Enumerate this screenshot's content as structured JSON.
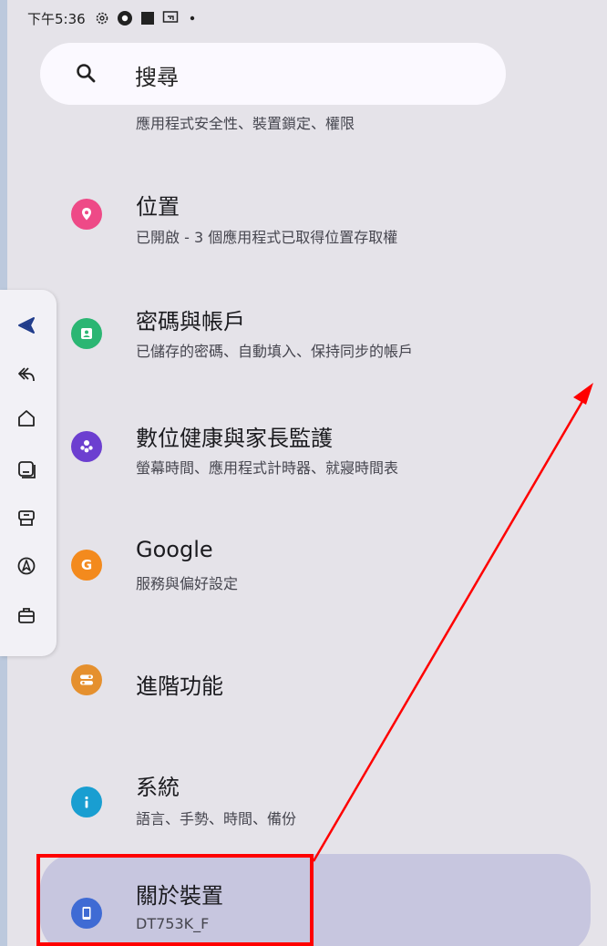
{
  "status_bar": {
    "time": "下午5:36"
  },
  "search": {
    "label": "搜尋"
  },
  "partial_item": {
    "subtitle": "應用程式安全性、裝置鎖定、權限"
  },
  "items": [
    {
      "title": "位置",
      "subtitle": "已開啟 - 3 個應用程式已取得位置存取權",
      "icon": "location-icon",
      "color": "#ee4a87"
    },
    {
      "title": "密碼與帳戶",
      "subtitle": "已儲存的密碼、自動填入、保持同步的帳戶",
      "icon": "account-icon",
      "color": "#2bb673"
    },
    {
      "title": "數位健康與家長監護",
      "subtitle": "螢幕時間、應用程式計時器、就寢時間表",
      "icon": "wellbeing-icon",
      "color": "#6c3fd0"
    },
    {
      "title": "Google",
      "subtitle": "服務與偏好設定",
      "icon": "google-icon",
      "color": "#f38a1d"
    },
    {
      "title": "進階功能",
      "subtitle": "",
      "icon": "advanced-icon",
      "color": "#e5902e"
    },
    {
      "title": "系統",
      "subtitle": "語言、手勢、時間、備份",
      "icon": "info-icon",
      "color": "#199ed1"
    },
    {
      "title": "關於裝置",
      "subtitle": "DT753K_F",
      "icon": "device-icon",
      "color": "#3f6bd4"
    }
  ],
  "side_nav": {
    "icons": [
      "back-triangle-icon",
      "reply-icon",
      "home-icon",
      "recent-apps-icon",
      "tray-icon",
      "compass-icon",
      "briefcase-icon"
    ]
  },
  "colors": {
    "background": "#e5e3e9",
    "selected": "#c7c6df",
    "annotation": "#ff0000"
  }
}
